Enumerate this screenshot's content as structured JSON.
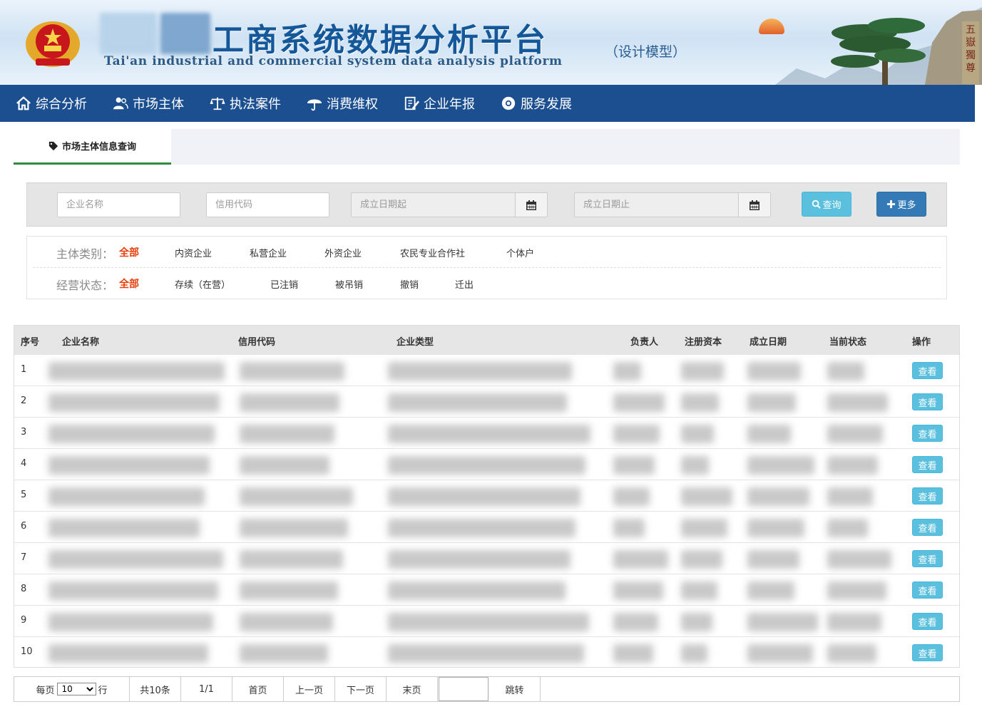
{
  "banner": {
    "title": "工商系统数据分析平台",
    "model": "（设计模型）",
    "english": "Tai'an industrial and commercial system data analysis platform",
    "seal_text": "五嶽獨尊"
  },
  "nav": {
    "items": [
      {
        "label": "综合分析",
        "icon": "home-icon"
      },
      {
        "label": "市场主体",
        "icon": "users-icon"
      },
      {
        "label": "执法案件",
        "icon": "scales-icon"
      },
      {
        "label": "消费维权",
        "icon": "umbrella-icon"
      },
      {
        "label": "企业年报",
        "icon": "edit-icon"
      },
      {
        "label": "服务发展",
        "icon": "chrome-icon"
      }
    ]
  },
  "tab": {
    "label": "市场主体信息查询",
    "icon": "tag-icon"
  },
  "search": {
    "name_placeholder": "企业名称",
    "code_placeholder": "信用代码",
    "date_from_placeholder": "成立日期起",
    "date_to_placeholder": "成立日期止",
    "query_label": "查询",
    "more_label": "更多"
  },
  "filters": {
    "type_label": "主体类别：",
    "type_options": [
      "全部",
      "内资企业",
      "私营企业",
      "外资企业",
      "农民专业合作社",
      "个体户"
    ],
    "status_label": "经营状态：",
    "status_options": [
      "全部",
      "存续（在营）",
      "已注销",
      "被吊销",
      "撤销",
      "迁出"
    ]
  },
  "table": {
    "headers": [
      "序号",
      "企业名称",
      "信用代码",
      "企业类型",
      "负责人",
      "注册资本",
      "成立日期",
      "当前状态",
      "操作"
    ],
    "rows": [
      {
        "no": "1",
        "action": "查看"
      },
      {
        "no": "2",
        "action": "查看"
      },
      {
        "no": "3",
        "action": "查看"
      },
      {
        "no": "4",
        "action": "查看"
      },
      {
        "no": "5",
        "action": "查看"
      },
      {
        "no": "6",
        "action": "查看"
      },
      {
        "no": "7",
        "action": "查看"
      },
      {
        "no": "8",
        "action": "查看"
      },
      {
        "no": "9",
        "action": "查看"
      },
      {
        "no": "10",
        "action": "查看"
      }
    ]
  },
  "pager": {
    "per_page_prefix": "每页",
    "per_page_value": "10",
    "per_page_suffix": "行",
    "total": "共10条",
    "page": "1/1",
    "first": "首页",
    "prev": "上一页",
    "next": "下一页",
    "last": "末页",
    "jump": "跳转"
  }
}
